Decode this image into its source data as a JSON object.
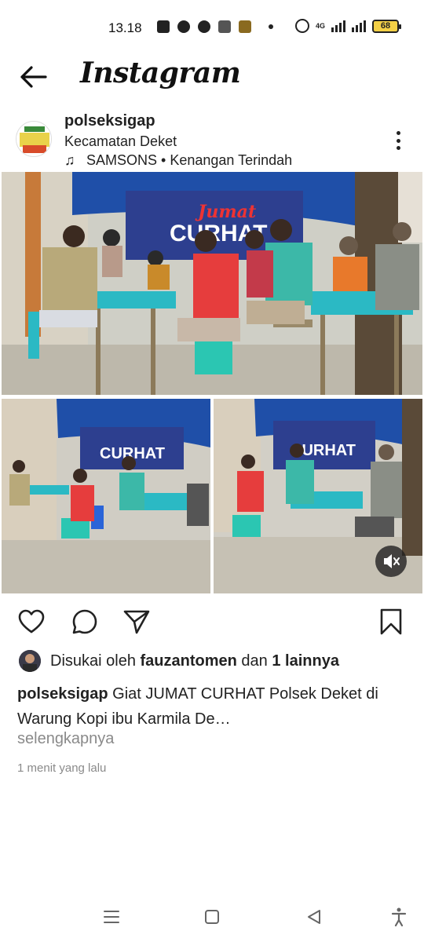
{
  "status_bar": {
    "time": "13.18",
    "network": "4G",
    "battery": "68",
    "icons": [
      "app-icon",
      "facebook-icon",
      "app-icon",
      "tiktok-icon",
      "app-icon",
      "dot-icon",
      "alarm-icon",
      "signal-icon",
      "signal-icon",
      "battery-icon"
    ]
  },
  "header": {
    "title": "Instagram",
    "back_icon": "back-arrow-icon"
  },
  "post": {
    "username": "polseksigap",
    "location": "Kecamatan Deket",
    "music": "SAMSONS • Kenangan Terindah",
    "music_icon": "music-note-icon",
    "banner_text": {
      "title_line1": "Jumat",
      "title_line2": "CURHAT"
    },
    "likes": {
      "prefix": "Disukai oleh",
      "user": "fauzantomen",
      "connector": "dan",
      "others": "1 lainnya"
    },
    "caption": {
      "username": "polseksigap",
      "text": "Giat JUMAT CURHAT Polsek Deket di Warung Kopi ibu Karmila De…"
    },
    "more_label": "selengkapnya",
    "time_ago": "1 menit yang lalu"
  },
  "actions": {
    "like_icon": "heart-icon",
    "comment_icon": "comment-icon",
    "share_icon": "send-icon",
    "save_icon": "bookmark-icon",
    "mute_icon": "muted-speaker-icon"
  },
  "nav_bar": {
    "items": [
      "menu-icon",
      "home-square-icon",
      "back-triangle-icon",
      "accessibility-icon"
    ]
  },
  "colors": {
    "text": "#222222",
    "muted": "#8a8a8a",
    "tent_blue": "#1f4fa8",
    "table_teal": "#2bb9c4"
  }
}
